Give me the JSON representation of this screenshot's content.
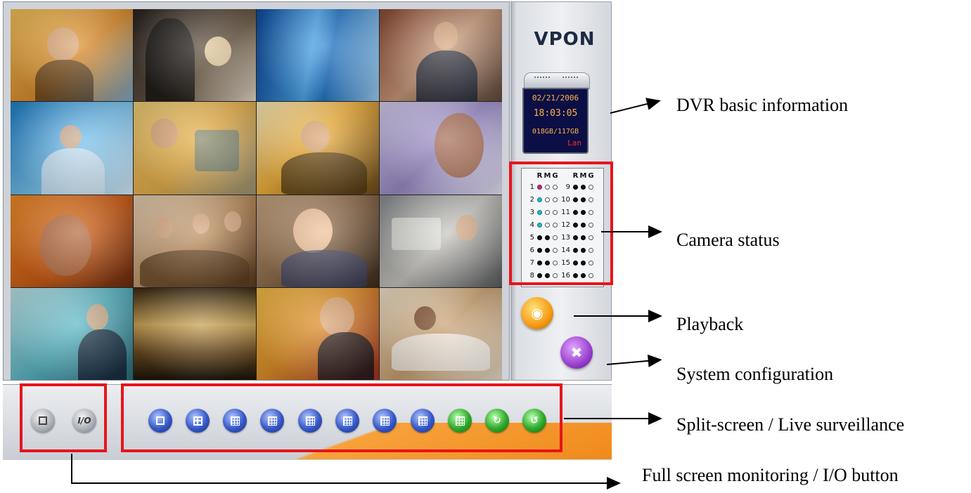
{
  "brand": {
    "logo": "VPON"
  },
  "dvr_info": {
    "date": "02/21/2006",
    "time": "18:03:05",
    "disk": "018GB/117GB",
    "network": "Lan"
  },
  "camera_status": {
    "header": [
      "R",
      "M",
      "G",
      "R",
      "M",
      "G"
    ],
    "rows": [
      {
        "left": "1",
        "right": "9"
      },
      {
        "left": "2",
        "right": "10"
      },
      {
        "left": "3",
        "right": "11"
      },
      {
        "left": "4",
        "right": "12"
      },
      {
        "left": "5",
        "right": "13"
      },
      {
        "left": "6",
        "right": "14"
      },
      {
        "left": "7",
        "right": "15"
      },
      {
        "left": "8",
        "right": "16"
      }
    ]
  },
  "toolbar": {
    "io_label": "I/O"
  },
  "annotations": {
    "dvr_info": "DVR basic information",
    "camera_status": "Camera status",
    "playback": "Playback",
    "system_config": "System configuration",
    "split_screen": "Split-screen / Live surveillance",
    "full_screen": "Full screen monitoring / I/O button"
  },
  "colors": {
    "highlight": "#e8141b",
    "lcd_background": "#0b0f45",
    "lcd_text": "#ffb347",
    "lan_text": "#ff2a2a",
    "split_buttons": "#3558c8",
    "live_buttons": "#2ea82a",
    "playback_button": "#f59a14",
    "config_button": "#9a3fd0"
  }
}
